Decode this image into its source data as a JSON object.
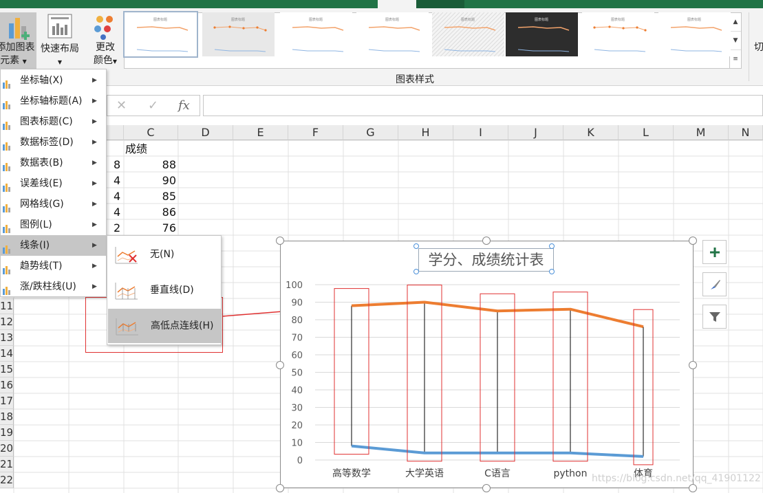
{
  "ribbon": {
    "add_element_label_l1": "添加图表",
    "add_element_label_l2": "元素",
    "quick_layout_label": "快速布局",
    "change_colors_label_l1": "更改",
    "change_colors_label_l2": "颜色",
    "styles_group_label": "图表样式",
    "switch_label": "切",
    "style_thumbs": [
      "图表标题",
      "图表标题",
      "图表标题",
      "图表标题",
      "图表标题",
      "图表标题",
      "图表标题",
      "图表标题"
    ]
  },
  "formula_bar": {
    "cancel": "✕",
    "enter": "✓",
    "fx": "fx"
  },
  "grid": {
    "columns": [
      "C",
      "D",
      "E",
      "F",
      "G",
      "H",
      "I",
      "J",
      "K",
      "L",
      "M",
      "N"
    ],
    "row_numbers": [
      "11",
      "12",
      "13",
      "14",
      "15",
      "16",
      "17",
      "18",
      "19",
      "20",
      "21",
      "22"
    ],
    "header_label": "成绩",
    "rows": [
      {
        "b": "8",
        "c": "88"
      },
      {
        "b": "4",
        "c": "90"
      },
      {
        "b": "4",
        "c": "85"
      },
      {
        "b": "4",
        "c": "86"
      },
      {
        "b": "2",
        "c": "76"
      }
    ]
  },
  "menu": {
    "items": [
      {
        "label": "坐标轴(X)",
        "icon": "axes-icon"
      },
      {
        "label": "坐标轴标题(A)",
        "icon": "axis-titles-icon"
      },
      {
        "label": "图表标题(C)",
        "icon": "chart-title-icon"
      },
      {
        "label": "数据标签(D)",
        "icon": "data-labels-icon"
      },
      {
        "label": "数据表(B)",
        "icon": "data-table-icon"
      },
      {
        "label": "误差线(E)",
        "icon": "error-bars-icon"
      },
      {
        "label": "网格线(G)",
        "icon": "gridlines-icon"
      },
      {
        "label": "图例(L)",
        "icon": "legend-icon"
      },
      {
        "label": "线条(I)",
        "icon": "lines-icon"
      },
      {
        "label": "趋势线(T)",
        "icon": "trendline-icon"
      },
      {
        "label": "涨/跌柱线(U)",
        "icon": "updown-bars-icon"
      }
    ]
  },
  "submenu": {
    "items": [
      {
        "label": "无(N)",
        "icon": "none-lines-icon"
      },
      {
        "label": "垂直线(D)",
        "icon": "drop-lines-icon"
      },
      {
        "label": "高低点连线(H)",
        "icon": "high-low-lines-icon"
      }
    ]
  },
  "chart_data": {
    "type": "line",
    "title": "学分、成绩统计表",
    "categories": [
      "高等数学",
      "大学英语",
      "C语言",
      "python",
      "体育"
    ],
    "series": [
      {
        "values": [
          88,
          90,
          85,
          86,
          76
        ],
        "color": "#ed7d31"
      },
      {
        "values": [
          8,
          4,
          4,
          4,
          2
        ],
        "color": "#5b9bd5"
      }
    ],
    "ylim": [
      0,
      100
    ],
    "yticks": [
      0,
      10,
      20,
      30,
      40,
      50,
      60,
      70,
      80,
      90,
      100
    ],
    "grid": true,
    "high_low_lines": true,
    "annotation_color": "#e03030"
  },
  "watermark": "https://blog.csdn.net/qq_41901122"
}
